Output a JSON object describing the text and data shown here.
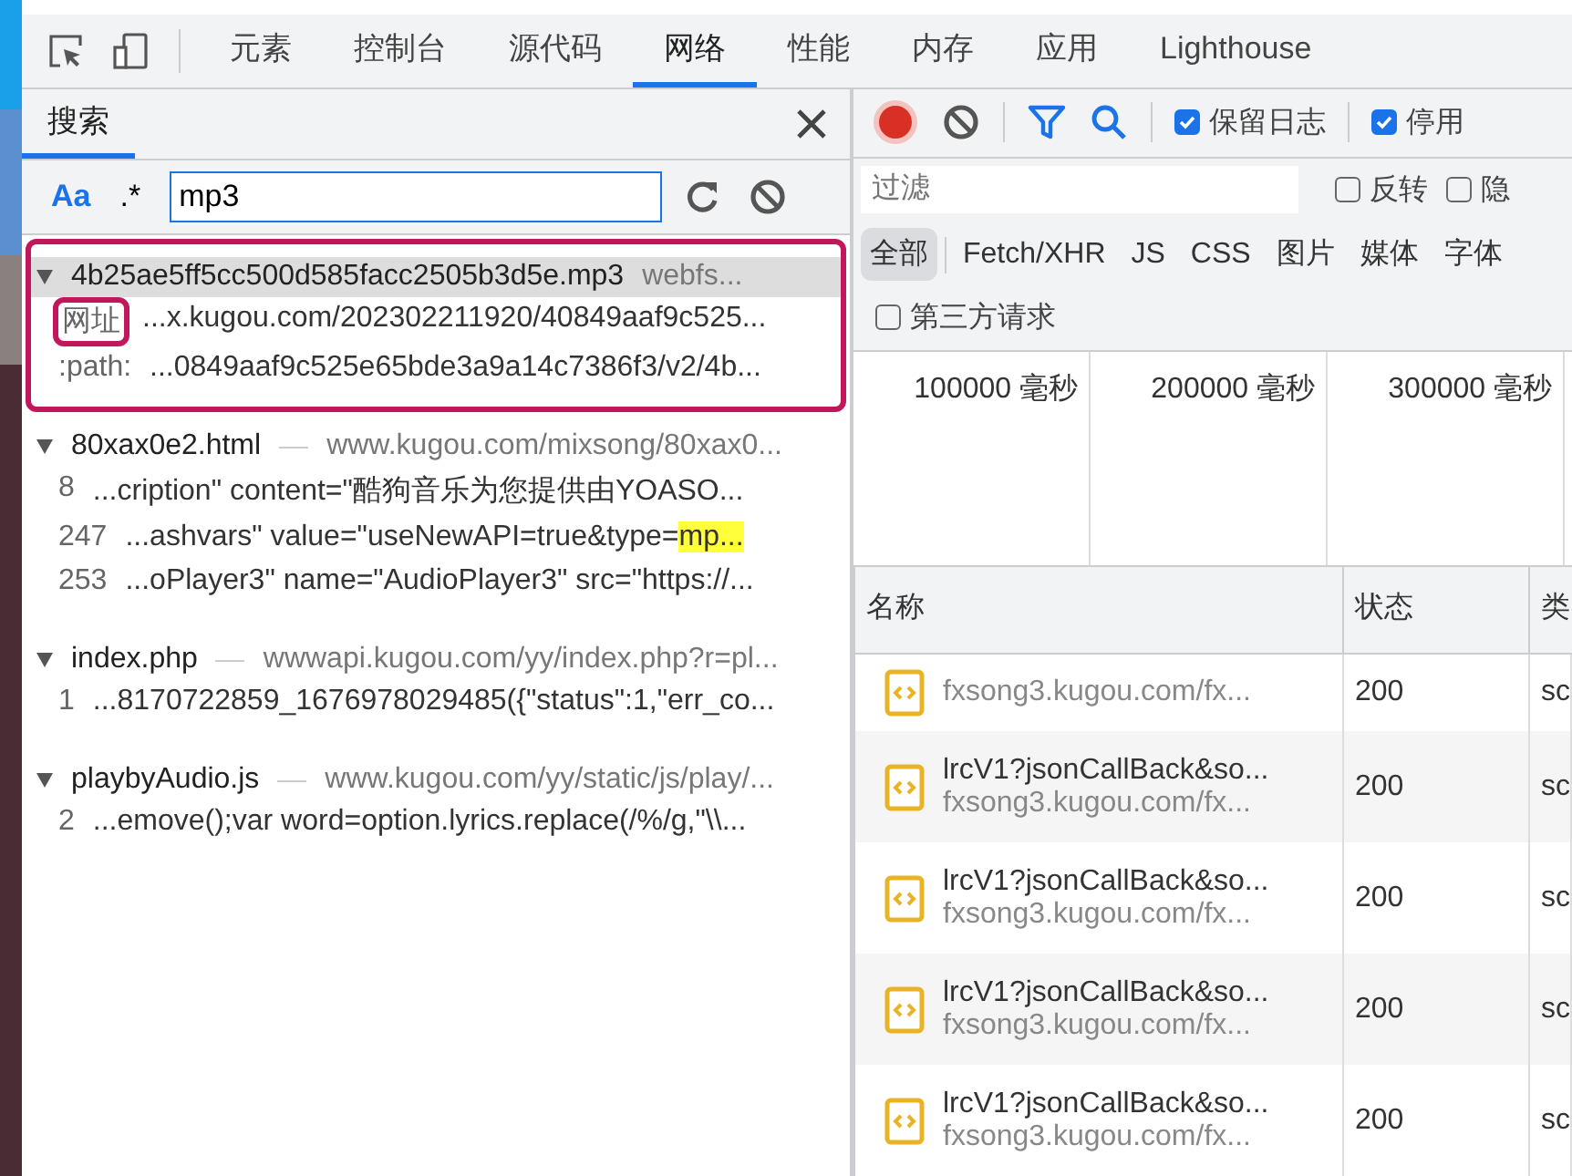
{
  "main_tabs": [
    {
      "label": "元素",
      "selected": false
    },
    {
      "label": "控制台",
      "selected": false
    },
    {
      "label": "源代码",
      "selected": false
    },
    {
      "label": "网络",
      "selected": true
    },
    {
      "label": "性能",
      "selected": false
    },
    {
      "label": "内存",
      "selected": false
    },
    {
      "label": "应用",
      "selected": false
    },
    {
      "label": "Lighthouse",
      "selected": false
    }
  ],
  "search_panel": {
    "title": "搜索",
    "case_toggle": "Aa",
    "regex_toggle": ".*",
    "query": "mp3",
    "results": [
      {
        "file": "4b25ae5ff5cc500d585facc2505b3d5e.mp3",
        "url": "webfs...",
        "selected": true,
        "highlighted": true,
        "matches": [
          {
            "line": "网址",
            "text": "...x.kugou.com/202302211920/40849aaf9c525...",
            "boxed": true
          },
          {
            "line": ":path:",
            "text": "...0849aaf9c525e65bde3a9a14c7386f3/v2/4b...",
            "boxed": false
          }
        ]
      },
      {
        "file": "80xax0e2.html",
        "url": "www.kugou.com/mixsong/80xax0...",
        "selected": false,
        "highlighted": false,
        "matches": [
          {
            "line": "8",
            "text": "...cription\" content=\"酷狗音乐为您提供由YOASO...",
            "boxed": false
          },
          {
            "line": "247",
            "text": "...ashvars\" value=\"useNewAPI=true&type=",
            "hit": "mp...",
            "boxed": false
          },
          {
            "line": "253",
            "text": "...oPlayer3\" name=\"AudioPlayer3\" src=\"https://...",
            "boxed": false
          }
        ]
      },
      {
        "file": "index.php",
        "url": "wwwapi.kugou.com/yy/index.php?r=pl...",
        "selected": false,
        "highlighted": false,
        "matches": [
          {
            "line": "1",
            "text": "...8170722859_1676978029485({\"status\":1,\"err_co...",
            "boxed": false
          }
        ]
      },
      {
        "file": "playbyAudio.js",
        "url": "www.kugou.com/yy/static/js/play/...",
        "selected": false,
        "highlighted": false,
        "matches": [
          {
            "line": "2",
            "text": "...emove();var word=option.lyrics.replace(/%/g,\"\\\\...",
            "boxed": false
          }
        ]
      }
    ]
  },
  "network": {
    "preserve_log": {
      "label": "保留日志",
      "checked": true
    },
    "disable_cache": {
      "label": "停用",
      "checked": true
    },
    "filter": {
      "placeholder": "过滤"
    },
    "invert": {
      "label": "反转",
      "checked": false
    },
    "hide": {
      "label": "隐",
      "checked": false
    },
    "type_filters": [
      {
        "label": "全部",
        "selected": true
      },
      {
        "label": "Fetch/XHR",
        "selected": false
      },
      {
        "label": "JS",
        "selected": false
      },
      {
        "label": "CSS",
        "selected": false
      },
      {
        "label": "图片",
        "selected": false
      },
      {
        "label": "媒体",
        "selected": false
      },
      {
        "label": "字体",
        "selected": false
      }
    ],
    "third_party": {
      "label": "第三方请求",
      "checked": false
    },
    "timeline_ticks": [
      "100000 毫秒",
      "200000 毫秒",
      "300000 毫秒"
    ],
    "columns": [
      "名称",
      "状态",
      "类"
    ],
    "rows": [
      {
        "url": "fxsong3.kugou.com/fx...",
        "status": "200",
        "type": "sc"
      },
      {
        "name": "lrcV1?jsonCallBack&so...",
        "url": "fxsong3.kugou.com/fx...",
        "status": "200",
        "type": "sc"
      },
      {
        "name": "lrcV1?jsonCallBack&so...",
        "url": "fxsong3.kugou.com/fx...",
        "status": "200",
        "type": "sc"
      },
      {
        "name": "lrcV1?jsonCallBack&so...",
        "url": "fxsong3.kugou.com/fx...",
        "status": "200",
        "type": "sc"
      },
      {
        "name": "lrcV1?jsonCallBack&so...",
        "url": "fxsong3.kugou.com/fx...",
        "status": "200",
        "type": "sc"
      }
    ]
  }
}
